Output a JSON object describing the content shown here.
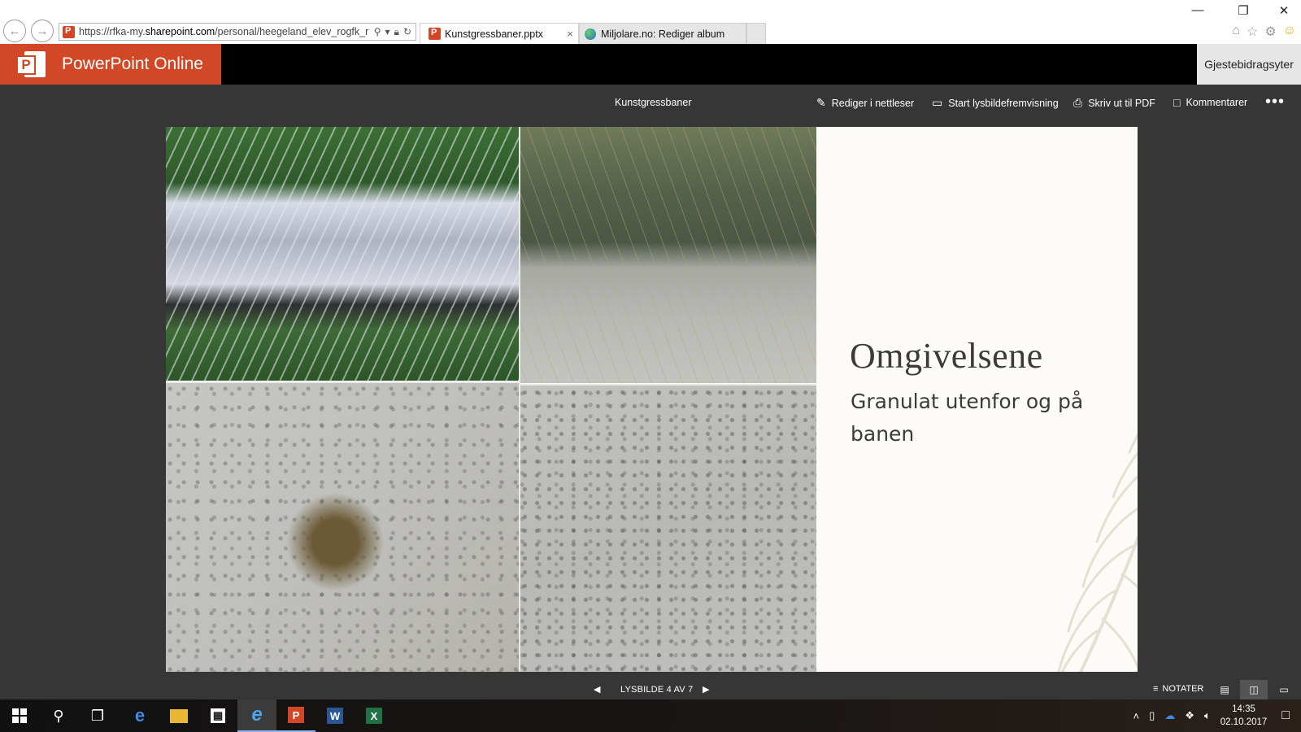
{
  "browser": {
    "url_prefix": "https://rfka-my.",
    "url_host": "sharepoint.com",
    "url_path": "/personal/heegeland_elev_rogfk_r",
    "tabs": [
      {
        "label": "Kunstgressbaner.pptx",
        "active": true
      },
      {
        "label": "Miljolare.no: Rediger album",
        "active": false
      }
    ],
    "close_glyph": "×"
  },
  "app": {
    "name": "PowerPoint Online",
    "logo_letter": "P",
    "guest_label": "Gjestebidragsyter",
    "brand_color": "#d24726"
  },
  "commandbar": {
    "doc_title": "Kunstgressbaner",
    "edit_label": "Rediger i nettleser",
    "slideshow_label": "Start lysbildefremvisning",
    "print_label": "Skriv ut til PDF",
    "comments_label": "Kommentarer",
    "more_label": "•••"
  },
  "slide": {
    "title": "Omgivelsene",
    "subtitle": "Granulat utenfor og på banen"
  },
  "statusbar": {
    "slide_counter": "LYSBILDE 4 AV 7",
    "notes_label": "NOTATER",
    "current_slide": 4,
    "total_slides": 7
  },
  "taskbar": {
    "time": "14:35",
    "date": "02.10.2017"
  },
  "icons": {
    "back": "back-arrow-icon",
    "forward": "forward-arrow-icon",
    "search": "search-icon",
    "lock": "lock-icon",
    "refresh": "refresh-icon",
    "home": "home-icon",
    "favorites": "star-icon",
    "settings": "gear-icon",
    "feedback": "smiley-icon"
  }
}
